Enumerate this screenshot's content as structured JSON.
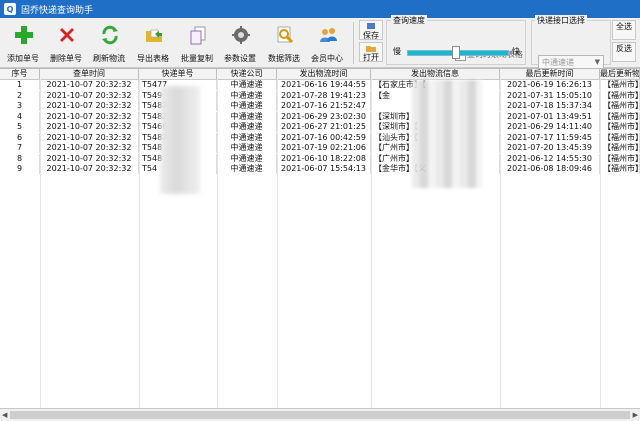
{
  "window": {
    "title": "固乔快递查询助手"
  },
  "toolbar": {
    "buttons": [
      {
        "label": "添加单号",
        "icon": "green-plus-icon"
      },
      {
        "label": "删除单号",
        "icon": "red-x-icon"
      },
      {
        "label": "刷新物流",
        "icon": "refresh-icon"
      },
      {
        "label": "导出表格",
        "icon": "folder-icon"
      },
      {
        "label": "批量复制",
        "icon": "copy-icon"
      },
      {
        "label": "参数设置",
        "icon": "gear-icon"
      },
      {
        "label": "数据筛选",
        "icon": "filter-icon"
      },
      {
        "label": "会员中心",
        "icon": "users-icon"
      }
    ],
    "save_label": "保存",
    "open_label": "打开",
    "speed_label": "查询速度",
    "slow_label": "慢",
    "fast_label": "快",
    "speed_value": 0.45,
    "scroll_check_label": "查询时滚动表格",
    "scroll_checked": true,
    "interface_label": "快递接口选择",
    "interface_value": "中通速递",
    "select_all_label": "全选",
    "invert_label": "反选"
  },
  "table": {
    "headers": [
      "序号",
      "查单时间",
      "快递单号",
      "快递公司",
      "发出物流时间",
      "发出物流信息",
      "最后更新时间",
      "最后更新物"
    ],
    "rows": [
      {
        "no": "1",
        "query_time": "2021-10-07 20:32:32",
        "tracking": "T5477",
        "company": "中通速递",
        "ship_time": "2021-06-16 19:44:55",
        "ship_info": "【石家庄市】【",
        "last_time": "2021-06-19 16:26:13",
        "last_info": "【福州市】"
      },
      {
        "no": "2",
        "query_time": "2021-10-07 20:32:32",
        "tracking": "T549",
        "company": "中通速递",
        "ship_time": "2021-07-28 19:41:23",
        "ship_info": "【金",
        "last_time": "2021-07-31 15:05:10",
        "last_info": "【福州市】"
      },
      {
        "no": "3",
        "query_time": "2021-10-07 20:32:32",
        "tracking": "T5487",
        "company": "中通速递",
        "ship_time": "2021-07-16 21:52:47",
        "ship_info": "",
        "last_time": "2021-07-18 15:37:34",
        "last_info": "【福州市】"
      },
      {
        "no": "4",
        "query_time": "2021-10-07 20:32:32",
        "tracking": "T5482",
        "company": "中通速递",
        "ship_time": "2021-06-29 23:02:30",
        "ship_info": "【深圳市】",
        "last_time": "2021-07-01 13:49:51",
        "last_info": "【福州市】"
      },
      {
        "no": "5",
        "query_time": "2021-10-07 20:32:32",
        "tracking": "T5466",
        "company": "中通速递",
        "ship_time": "2021-06-27 21:01:25",
        "ship_info": "【深圳市】【",
        "last_time": "2021-06-29 14:11:40",
        "last_info": "【福州市】"
      },
      {
        "no": "6",
        "query_time": "2021-10-07 20:32:32",
        "tracking": "T5487",
        "company": "中通速递",
        "ship_time": "2021-07-16 00:42:59",
        "ship_info": "【汕头市】【",
        "last_time": "2021-07-17 11:59:45",
        "last_info": "【福州市】"
      },
      {
        "no": "7",
        "query_time": "2021-10-07 20:32:32",
        "tracking": "T548",
        "company": "中通速递",
        "ship_time": "2021-07-19 02:21:06",
        "ship_info": "【广州市】",
        "last_time": "2021-07-20 13:45:39",
        "last_info": "【福州市】"
      },
      {
        "no": "8",
        "query_time": "2021-10-07 20:32:32",
        "tracking": "T548",
        "company": "中通速递",
        "ship_time": "2021-06-10 18:22:08",
        "ship_info": "【广州市】",
        "last_time": "2021-06-12 14:55:30",
        "last_info": "【福州市】"
      },
      {
        "no": "9",
        "query_time": "2021-10-07 20:32:32",
        "tracking": "T54",
        "company": "中通速递",
        "ship_time": "2021-06-07 15:54:13",
        "ship_info": "【金华市】【义",
        "last_time": "2021-06-08 18:09:46",
        "last_info": "【福州市】"
      }
    ]
  }
}
